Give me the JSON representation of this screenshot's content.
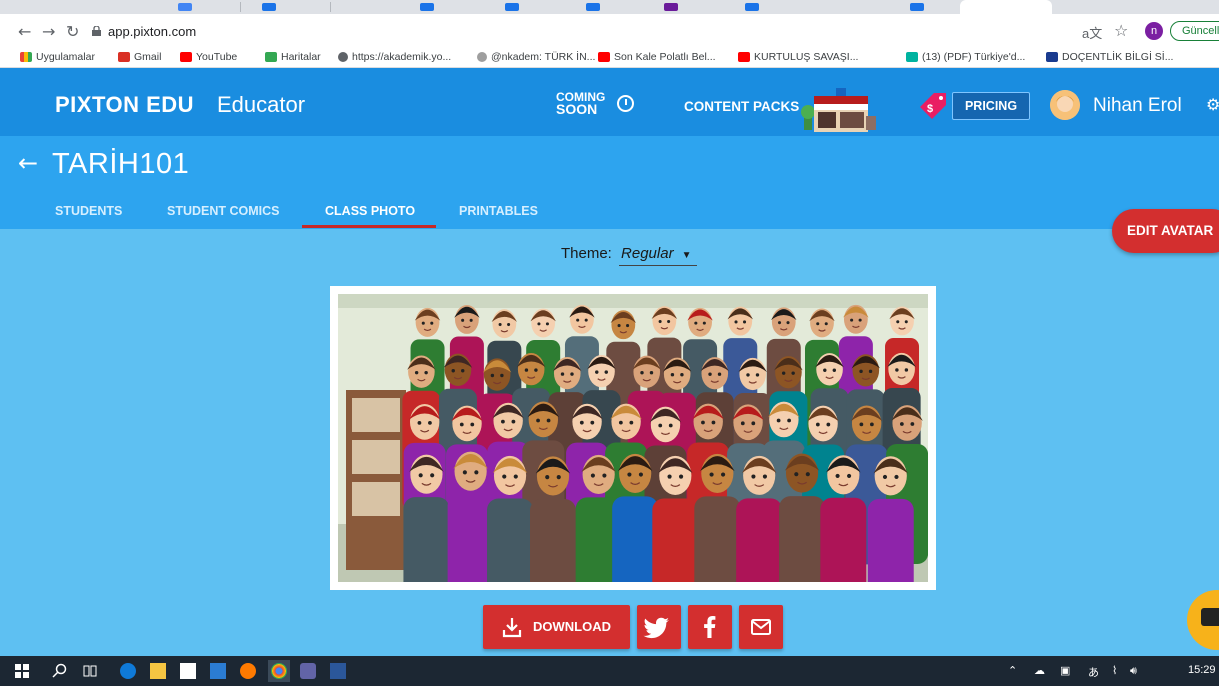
{
  "browser": {
    "url": "app.pixton.com",
    "update_label": "Güncelle",
    "profile_initial": "n",
    "bookmarks": [
      "Uygulamalar",
      "Gmail",
      "YouTube",
      "Haritalar",
      "https://akademik.yo...",
      "@nkadem: TÜRK İN...",
      "Son Kale Polatlı Bel...",
      "KURTULUŞ SAVAŞI...",
      "(13) (PDF) Türkiye'd...",
      "DOÇENTLİK BİLGİ Sİ..."
    ]
  },
  "header": {
    "brand": "PIXTON EDU",
    "brand_sub": "Educator",
    "coming_line1": "COMING",
    "coming_line2": "SOON",
    "content_packs": "CONTENT PACKS",
    "pricing": "PRICING",
    "username": "Nihan Erol"
  },
  "class": {
    "title": "TARİH101",
    "tabs": [
      "STUDENTS",
      "STUDENT COMICS",
      "CLASS PHOTO",
      "PRINTABLES"
    ],
    "active_tab": "CLASS PHOTO"
  },
  "edit_avatar": "EDIT AVATAR",
  "theme": {
    "label": "Theme:",
    "value": "Regular"
  },
  "actions": {
    "download": "DOWNLOAD"
  },
  "taskbar": {
    "time": "15:29"
  },
  "colors": {
    "header_blue": "#1a8de0",
    "subheader_blue": "#2da4ef",
    "page_blue": "#5ec0f2",
    "accent_red": "#d32f2f"
  }
}
